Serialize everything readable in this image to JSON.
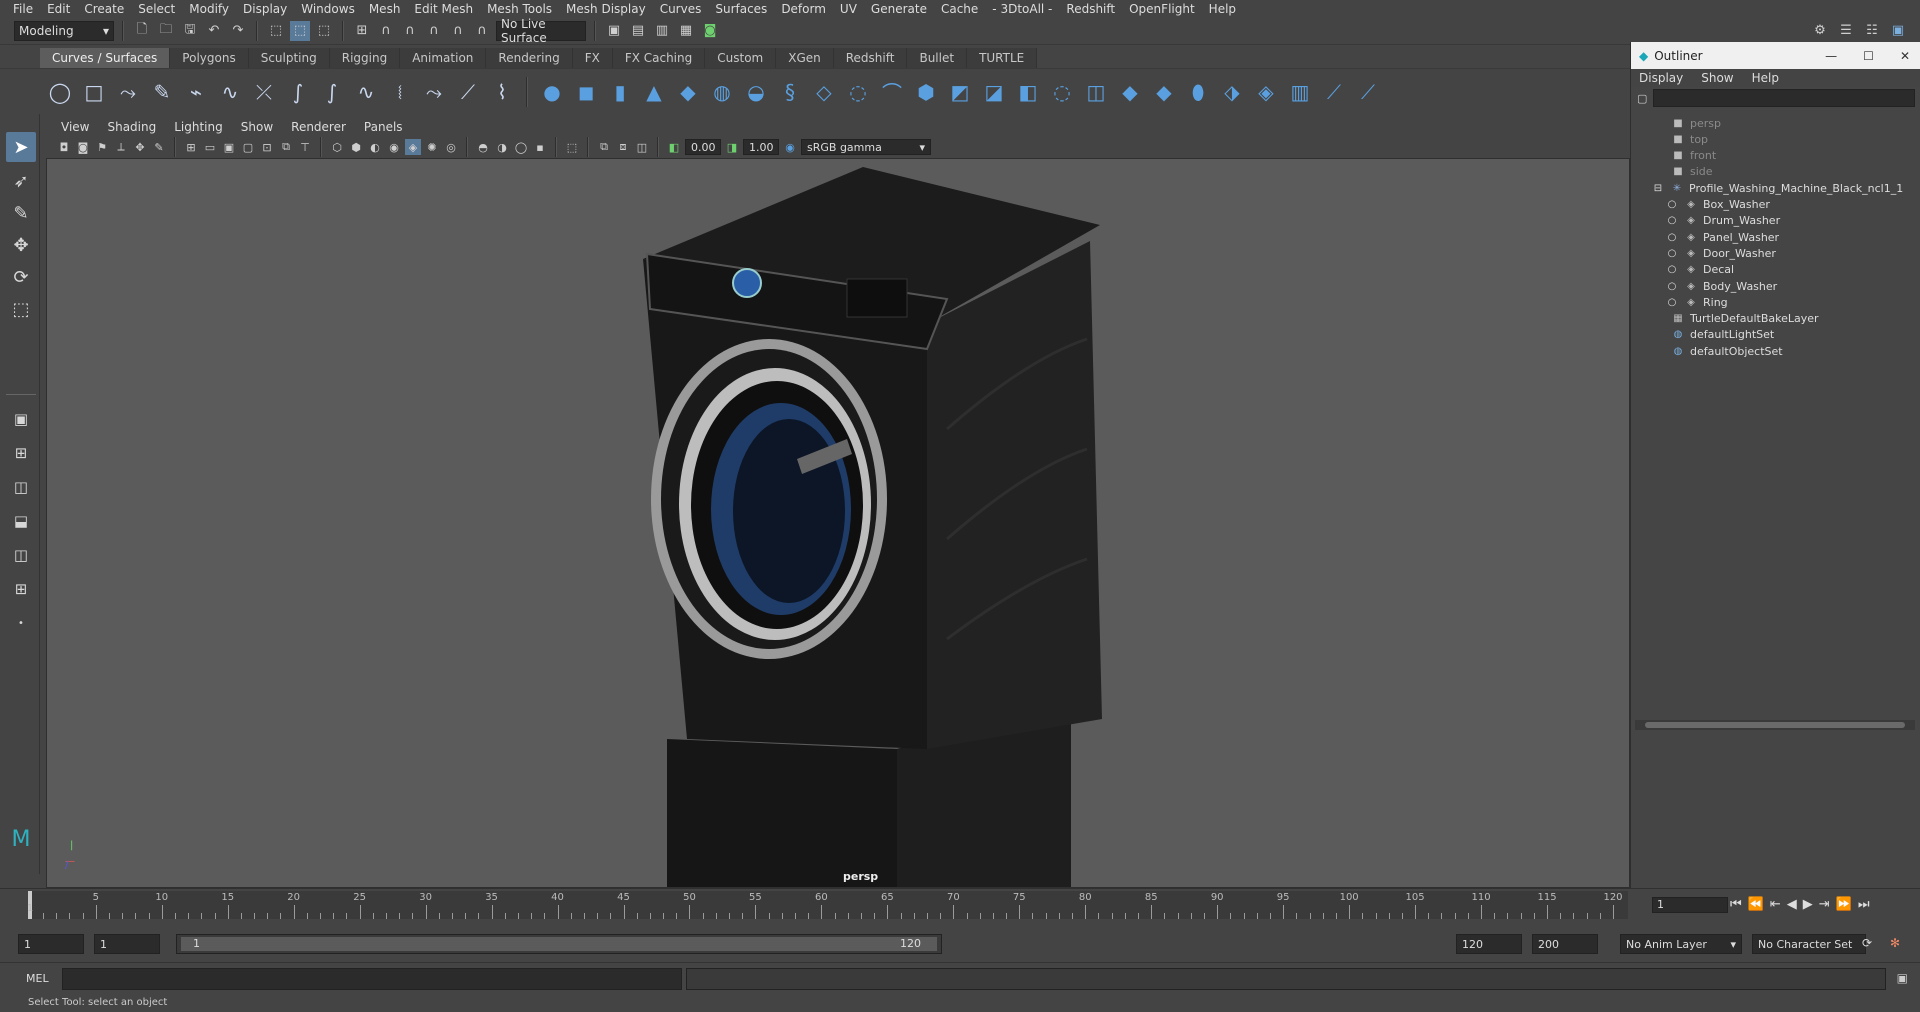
{
  "menubar": [
    "File",
    "Edit",
    "Create",
    "Select",
    "Modify",
    "Display",
    "Windows",
    "Mesh",
    "Edit Mesh",
    "Mesh Tools",
    "Mesh Display",
    "Curves",
    "Surfaces",
    "Deform",
    "UV",
    "Generate",
    "Cache",
    "- 3DtoAll -",
    "Redshift",
    "OpenFlight",
    "Help"
  ],
  "statusline": {
    "mode": "Modeling",
    "live_surface": "No Live Surface"
  },
  "shelf_tabs": [
    "Curves / Surfaces",
    "Polygons",
    "Sculpting",
    "Rigging",
    "Animation",
    "Rendering",
    "FX",
    "FX Caching",
    "Custom",
    "XGen",
    "Redshift",
    "Bullet",
    "TURTLE"
  ],
  "panel_menu": [
    "View",
    "Shading",
    "Lighting",
    "Show",
    "Renderer",
    "Panels"
  ],
  "panel_toolbar": {
    "exposure": "0.00",
    "gamma": "1.00",
    "color_space": "sRGB gamma"
  },
  "viewport": {
    "camera": "persp"
  },
  "outliner": {
    "title": "Outliner",
    "menu": [
      "Display",
      "Show",
      "Help"
    ],
    "items": [
      {
        "label": "persp",
        "icon": "camera-icon",
        "indent": 0,
        "dim": true
      },
      {
        "label": "top",
        "icon": "camera-icon",
        "indent": 0,
        "dim": true
      },
      {
        "label": "front",
        "icon": "camera-icon",
        "indent": 0,
        "dim": true
      },
      {
        "label": "side",
        "icon": "camera-icon",
        "indent": 0,
        "dim": true
      },
      {
        "label": "Profile_Washing_Machine_Black_ncl1_1",
        "icon": "group-icon",
        "indent": 0,
        "dim": false,
        "expanded": true
      },
      {
        "label": "Box_Washer",
        "icon": "mesh-icon",
        "indent": 1,
        "dim": false
      },
      {
        "label": "Drum_Washer",
        "icon": "mesh-icon",
        "indent": 1,
        "dim": false
      },
      {
        "label": "Panel_Washer",
        "icon": "mesh-icon",
        "indent": 1,
        "dim": false
      },
      {
        "label": "Door_Washer",
        "icon": "mesh-icon",
        "indent": 1,
        "dim": false
      },
      {
        "label": "Decal",
        "icon": "mesh-icon",
        "indent": 1,
        "dim": false
      },
      {
        "label": "Body_Washer",
        "icon": "mesh-icon",
        "indent": 1,
        "dim": false
      },
      {
        "label": "Ring",
        "icon": "mesh-icon",
        "indent": 1,
        "dim": false
      },
      {
        "label": "TurtleDefaultBakeLayer",
        "icon": "bake-layer-icon",
        "indent": 0,
        "dim": false
      },
      {
        "label": "defaultLightSet",
        "icon": "set-icon",
        "indent": 0,
        "dim": false
      },
      {
        "label": "defaultObjectSet",
        "icon": "set-icon",
        "indent": 0,
        "dim": false
      }
    ]
  },
  "timeslider": {
    "ticks": [
      "5",
      "10",
      "15",
      "20",
      "25",
      "30",
      "35",
      "40",
      "45",
      "50",
      "55",
      "60",
      "65",
      "70",
      "75",
      "80",
      "85",
      "90",
      "95",
      "100",
      "105",
      "110",
      "115",
      "120"
    ],
    "start_label": "1",
    "current_frame": "1"
  },
  "range": {
    "start": "1",
    "playback_start": "1",
    "bar_start": "1",
    "bar_end": "120",
    "playback_end": "120",
    "end": "200",
    "anim_layer": "No Anim Layer",
    "character_set": "No Character Set"
  },
  "cmdline": {
    "language": "MEL"
  },
  "helpline": "Select Tool: select an object",
  "colors": {
    "accent": "#5a7a9a",
    "viewport_bg": "#5b5b5b",
    "panel_bg": "#444444"
  }
}
